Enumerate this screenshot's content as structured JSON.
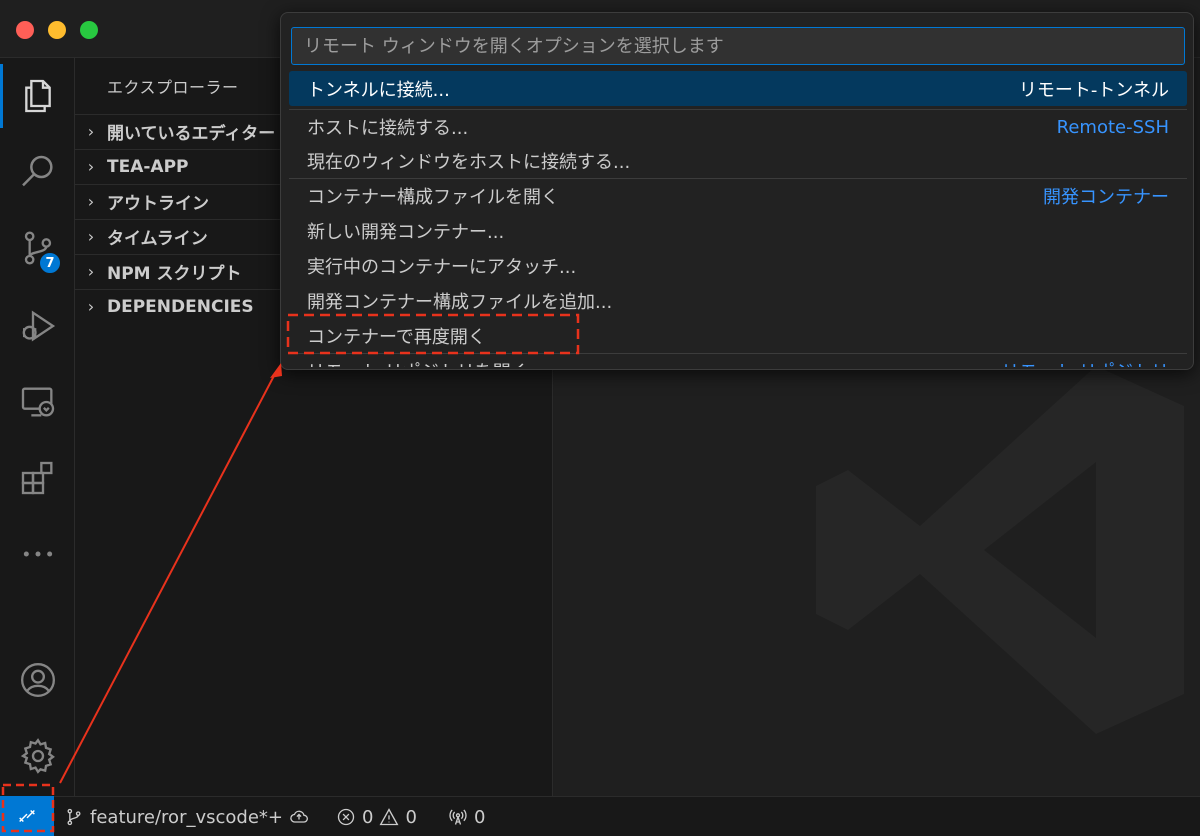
{
  "sidebar": {
    "title": "エクスプローラー",
    "sections": [
      "開いているエディター",
      "TEA-APP",
      "アウトライン",
      "タイムライン",
      "NPM スクリプト",
      "DEPENDENCIES"
    ]
  },
  "activity_bar": {
    "scm_badge": "7",
    "icons": [
      "explorer-icon",
      "search-icon",
      "source-control-icon",
      "run-debug-icon",
      "remote-explorer-icon",
      "extensions-icon",
      "more-icon",
      "account-icon",
      "settings-icon"
    ]
  },
  "quick_pick": {
    "placeholder": "リモート ウィンドウを開くオプションを選択します",
    "items": [
      {
        "label": "トンネルに接続...",
        "detail": "リモート-トンネル"
      },
      {
        "label": "ホストに接続する...",
        "detail": "Remote-SSH"
      },
      {
        "label": "現在のウィンドウをホストに接続する...",
        "detail": ""
      },
      {
        "label": "コンテナー構成ファイルを開く",
        "detail": "開発コンテナー"
      },
      {
        "label": "新しい開発コンテナー...",
        "detail": ""
      },
      {
        "label": "実行中のコンテナーにアタッチ...",
        "detail": ""
      },
      {
        "label": "開発コンテナー構成ファイルを追加...",
        "detail": ""
      },
      {
        "label": "コンテナーで再度開く",
        "detail": ""
      },
      {
        "label": "リモート リポジトリを開く...",
        "detail": "リモート リポジトリ"
      }
    ]
  },
  "status_bar": {
    "branch": "feature/ror_vscode*+",
    "errors": "0",
    "warnings": "0",
    "ports": "0"
  },
  "colors": {
    "accent": "#0078d4",
    "annotation": "#e8321c",
    "selection": "#04395e",
    "link": "#3794ff"
  }
}
